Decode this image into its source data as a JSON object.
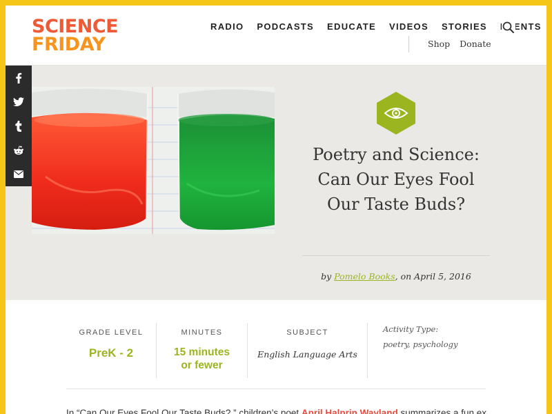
{
  "brand": {
    "logo_line1": "SCIENCE",
    "logo_line2": "FRIDAY",
    "colors": {
      "accent_green": "#9bb520",
      "accent_red": "#e64a3c",
      "accent_orange": "#f7941d",
      "frame_yellow": "#f5c518"
    }
  },
  "nav": {
    "items": [
      "RADIO",
      "PODCASTS",
      "EDUCATE",
      "VIDEOS",
      "STORIES",
      "EVENTS"
    ],
    "search_icon": "search-icon",
    "sub_items": [
      "Shop",
      "Donate"
    ]
  },
  "share": {
    "icons": [
      "facebook-icon",
      "twitter-icon",
      "tumblr-icon",
      "reddit-icon",
      "email-icon"
    ],
    "glyphs": [
      "f",
      "",
      "t",
      "",
      ""
    ]
  },
  "hero": {
    "badge_icon": "eye-icon",
    "title": "Poetry and Science: Can Our Eyes Fool Our Taste Buds?",
    "by_prefix": "by ",
    "author": "Pomelo Books",
    "date_text": ", on April 5, 2016"
  },
  "meta": {
    "grade_label": "GRADE LEVEL",
    "grade_value": "PreK - 2",
    "minutes_label": "MINUTES",
    "minutes_value_1": "15 minutes",
    "minutes_value_2": "or fewer",
    "subject_label": "SUBJECT",
    "subject_value": "English Language Arts",
    "activity_label": "Activity Type:",
    "activity_value": "poetry, psychology"
  },
  "intro": {
    "before": "In “Can Our Eyes Fool Our Taste Buds?,” children’s poet ",
    "link": "April Halprin Wayland",
    "after": " summarizes a fun experiment"
  }
}
